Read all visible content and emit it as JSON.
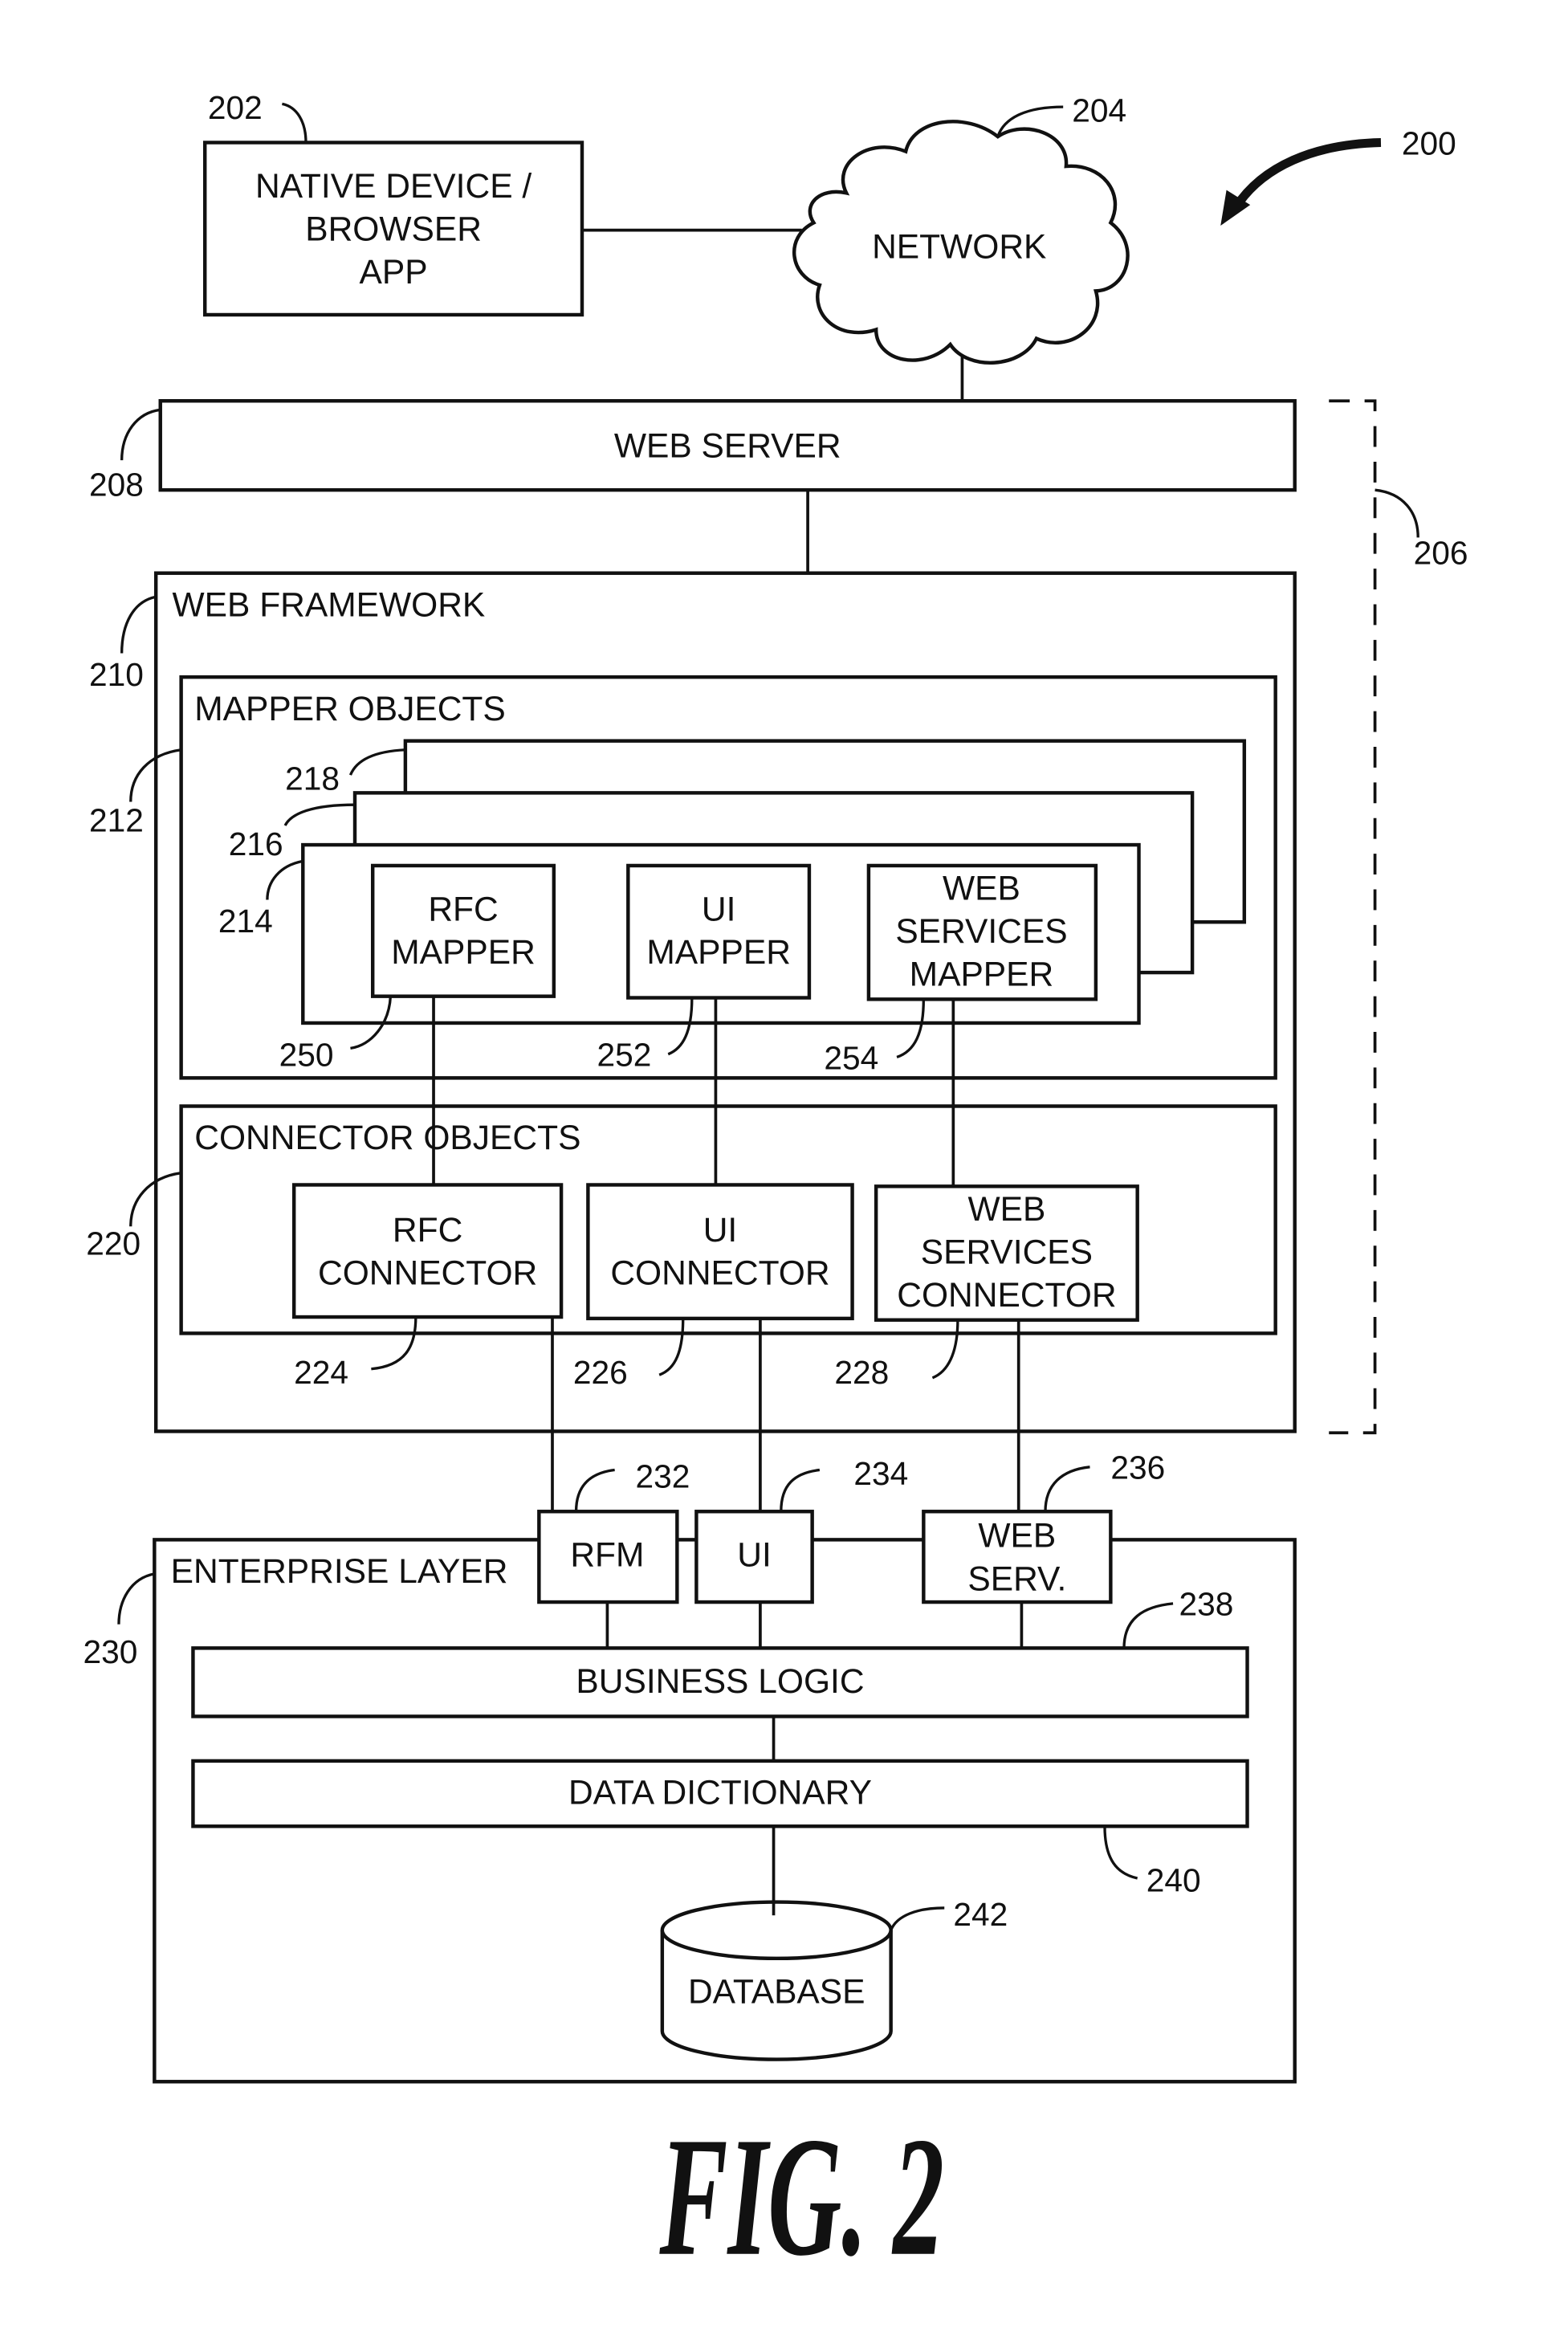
{
  "figure": {
    "caption": "FIG. 2",
    "system_ref": "200"
  },
  "nodes": {
    "native_app": {
      "ref": "202",
      "lines": [
        "NATIVE DEVICE /",
        "BROWSER",
        "APP"
      ]
    },
    "network": {
      "ref": "204",
      "label": "NETWORK"
    },
    "middleware_group": {
      "ref": "206"
    },
    "web_server": {
      "ref": "208",
      "label": "WEB SERVER"
    },
    "web_framework": {
      "ref": "210",
      "label": "WEB FRAMEWORK"
    },
    "mapper_objects": {
      "ref": "212",
      "label": "MAPPER OBJECTS"
    },
    "mapper_set_1": {
      "ref": "214"
    },
    "mapper_set_2": {
      "ref": "216"
    },
    "mapper_set_3": {
      "ref": "218"
    },
    "rfc_mapper": {
      "ref": "250",
      "lines": [
        "RFC",
        "MAPPER"
      ]
    },
    "ui_mapper": {
      "ref": "252",
      "lines": [
        "UI",
        "MAPPER"
      ]
    },
    "ws_mapper": {
      "ref": "254",
      "lines": [
        "WEB",
        "SERVICES",
        "MAPPER"
      ]
    },
    "connector_objects": {
      "ref": "220",
      "label": "CONNECTOR OBJECTS"
    },
    "rfc_connector": {
      "ref": "224",
      "lines": [
        "RFC",
        "CONNECTOR"
      ]
    },
    "ui_connector": {
      "ref": "226",
      "lines": [
        "UI",
        "CONNECTOR"
      ]
    },
    "ws_connector": {
      "ref": "228",
      "lines": [
        "WEB",
        "SERVICES",
        "CONNECTOR"
      ]
    },
    "enterprise_layer": {
      "ref": "230",
      "label": "ENTERPRISE LAYER"
    },
    "rfm": {
      "ref": "232",
      "label": "RFM"
    },
    "ui_iface": {
      "ref": "234",
      "label": "UI"
    },
    "web_serv": {
      "ref": "236",
      "lines": [
        "WEB",
        "SERV."
      ]
    },
    "business_logic": {
      "ref": "238",
      "label": "BUSINESS LOGIC"
    },
    "data_dictionary": {
      "ref": "240",
      "label": "DATA DICTIONARY"
    },
    "database": {
      "ref": "242",
      "label": "DATABASE"
    }
  }
}
